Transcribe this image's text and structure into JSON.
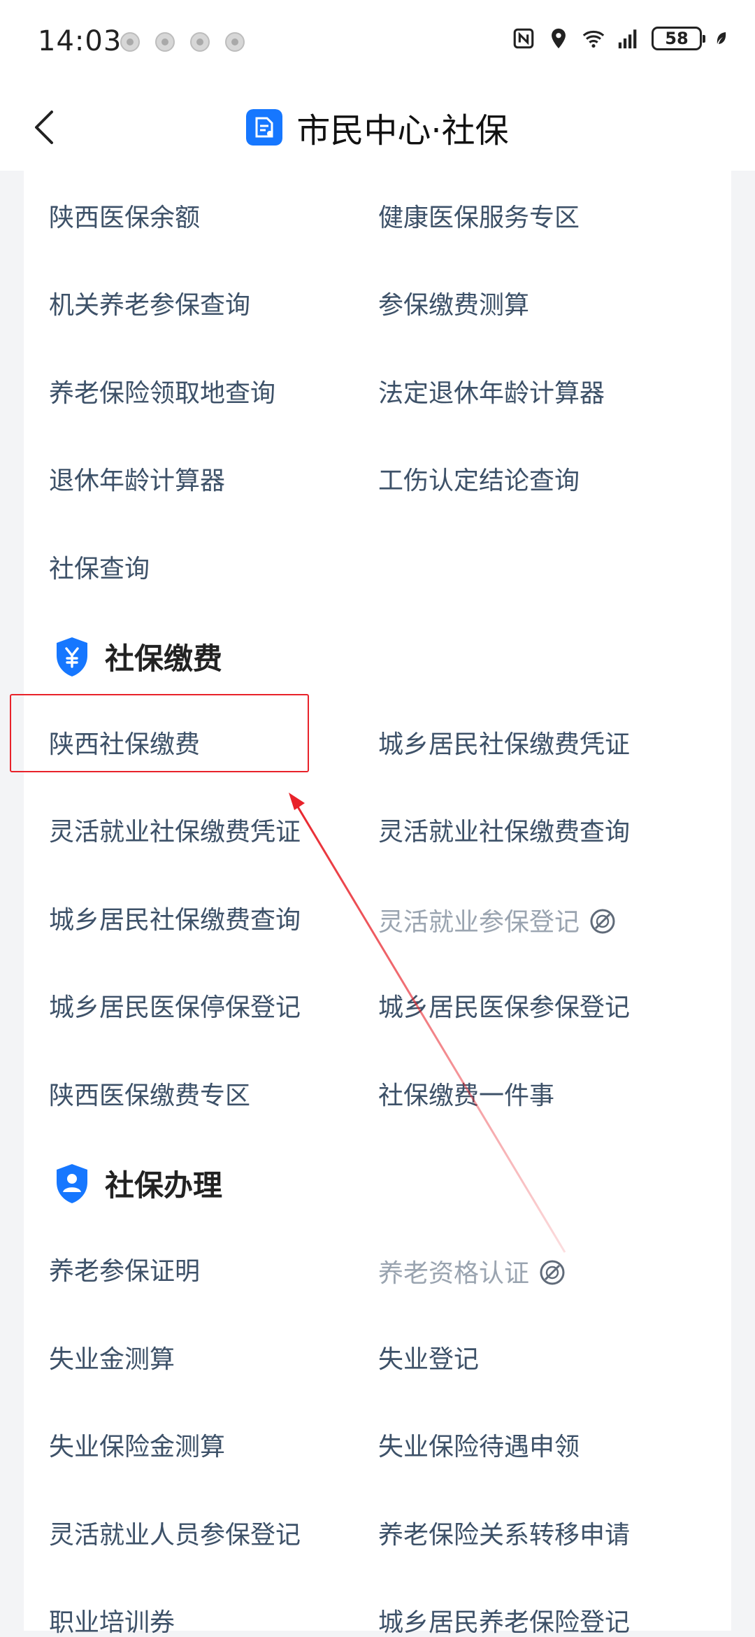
{
  "status_bar": {
    "time": "14:03",
    "battery": "58"
  },
  "nav": {
    "title": "市民中心·社保"
  },
  "top_items": [
    {
      "label": "陕西医保余额",
      "disabled": false
    },
    {
      "label": "健康医保服务专区",
      "disabled": false
    },
    {
      "label": "机关养老参保查询",
      "disabled": false
    },
    {
      "label": "参保缴费测算",
      "disabled": false
    },
    {
      "label": "养老保险领取地查询",
      "disabled": false
    },
    {
      "label": "法定退休年龄计算器",
      "disabled": false
    },
    {
      "label": "退休年龄计算器",
      "disabled": false
    },
    {
      "label": "工伤认定结论查询",
      "disabled": false
    },
    {
      "label": "社保查询",
      "disabled": false
    }
  ],
  "sections": [
    {
      "title": "社保缴费",
      "icon": "yuan-shield-icon",
      "items": [
        {
          "label": "陕西社保缴费",
          "disabled": false
        },
        {
          "label": "城乡居民社保缴费凭证",
          "disabled": false
        },
        {
          "label": "灵活就业社保缴费凭证",
          "disabled": false
        },
        {
          "label": "灵活就业社保缴费查询",
          "disabled": false
        },
        {
          "label": "城乡居民社保缴费查询",
          "disabled": false
        },
        {
          "label": "灵活就业参保登记",
          "disabled": true
        },
        {
          "label": "城乡居民医保停保登记",
          "disabled": false
        },
        {
          "label": "城乡居民医保参保登记",
          "disabled": false
        },
        {
          "label": "陕西医保缴费专区",
          "disabled": false
        },
        {
          "label": "社保缴费一件事",
          "disabled": false
        }
      ]
    },
    {
      "title": "社保办理",
      "icon": "person-shield-icon",
      "items": [
        {
          "label": "养老参保证明",
          "disabled": false
        },
        {
          "label": "养老资格认证",
          "disabled": true
        },
        {
          "label": "失业金测算",
          "disabled": false
        },
        {
          "label": "失业登记",
          "disabled": false
        },
        {
          "label": "失业保险金测算",
          "disabled": false
        },
        {
          "label": "失业保险待遇申领",
          "disabled": false
        },
        {
          "label": "灵活就业人员参保登记",
          "disabled": false
        },
        {
          "label": "养老保险关系转移申请",
          "disabled": false
        },
        {
          "label": "职业培训券",
          "disabled": false
        },
        {
          "label": "城乡居民养老保险登记",
          "disabled": false
        }
      ]
    }
  ],
  "colors": {
    "brand": "#1677ff",
    "item_text": "#3d5168",
    "disabled_text": "#9aa4b0",
    "highlight": "#e8222a"
  }
}
